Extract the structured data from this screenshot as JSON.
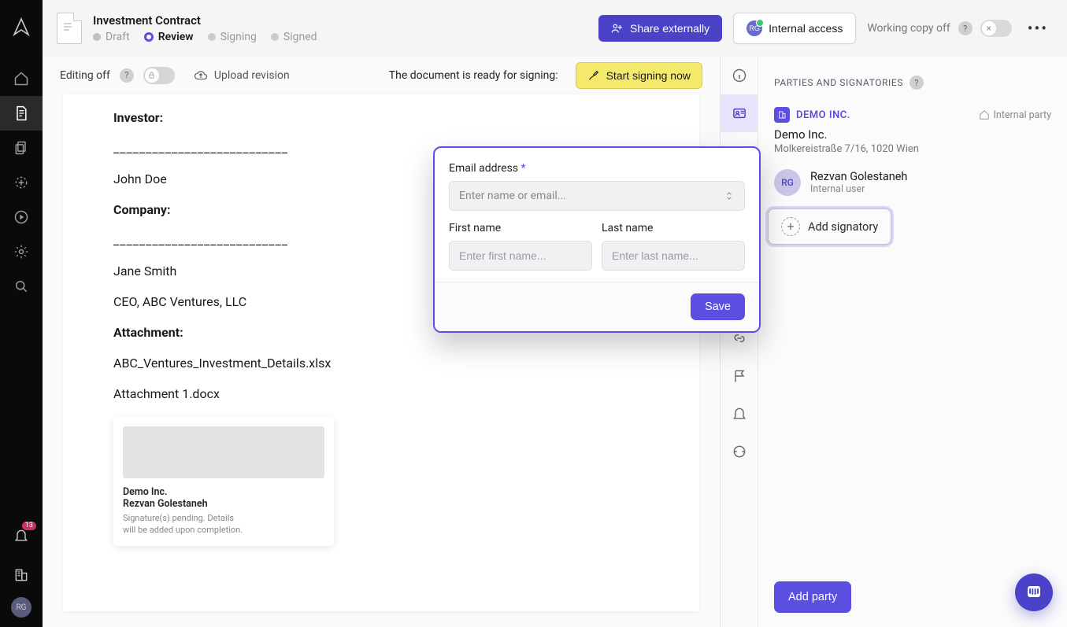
{
  "leftRail": {
    "notificationCount": "13",
    "avatarInitials": "RG"
  },
  "header": {
    "title": "Investment Contract",
    "steps": {
      "draft": "Draft",
      "review": "Review",
      "signing": "Signing",
      "signed": "Signed"
    },
    "shareLabel": "Share externally",
    "internalLabel": "Internal access",
    "internalChip": "RG",
    "workingCopy": "Working copy off",
    "toggleKnob": "×"
  },
  "toolbar": {
    "editingLabel": "Editing off",
    "uploadLabel": "Upload revision",
    "readyText": "The document is ready for signing:",
    "startSigning": "Start signing now"
  },
  "doc": {
    "investorLabel": "Investor:",
    "blank1": "___________________________",
    "investorName": "John Doe",
    "companyLabel": "Company:",
    "blank2": "___________________________",
    "ceoName": "Jane Smith",
    "ceoTitle": "CEO, ABC Ventures, LLC",
    "attachmentLabel": "Attachment:",
    "attachment1": "ABC_Ventures_Investment_Details.xlsx",
    "attachment2": "Attachment 1.docx",
    "sigCard": {
      "company": "Demo Inc.",
      "person": "Rezvan Golestaneh",
      "pending1": "Signature(s) pending. Details",
      "pending2": "will be added upon completion."
    }
  },
  "panel": {
    "title": "PARTIES AND SIGNATORIES",
    "partyTag": "DEMO INC.",
    "internalParty": "Internal party",
    "partyFull": "Demo Inc.",
    "partyAddress": "Molkereistraße 7/16, 1020 Wien",
    "signatory": {
      "initials": "RG",
      "name": "Rezvan Golestaneh",
      "role": "Internal user"
    },
    "addSignatory": "Add signatory",
    "addParty": "Add party"
  },
  "popover": {
    "emailLabel": "Email address",
    "emailRequired": "*",
    "emailPlaceholder": "Enter name or email...",
    "firstNameLabel": "First name",
    "firstNamePlaceholder": "Enter first name...",
    "lastNameLabel": "Last name",
    "lastNamePlaceholder": "Enter last name...",
    "save": "Save"
  }
}
